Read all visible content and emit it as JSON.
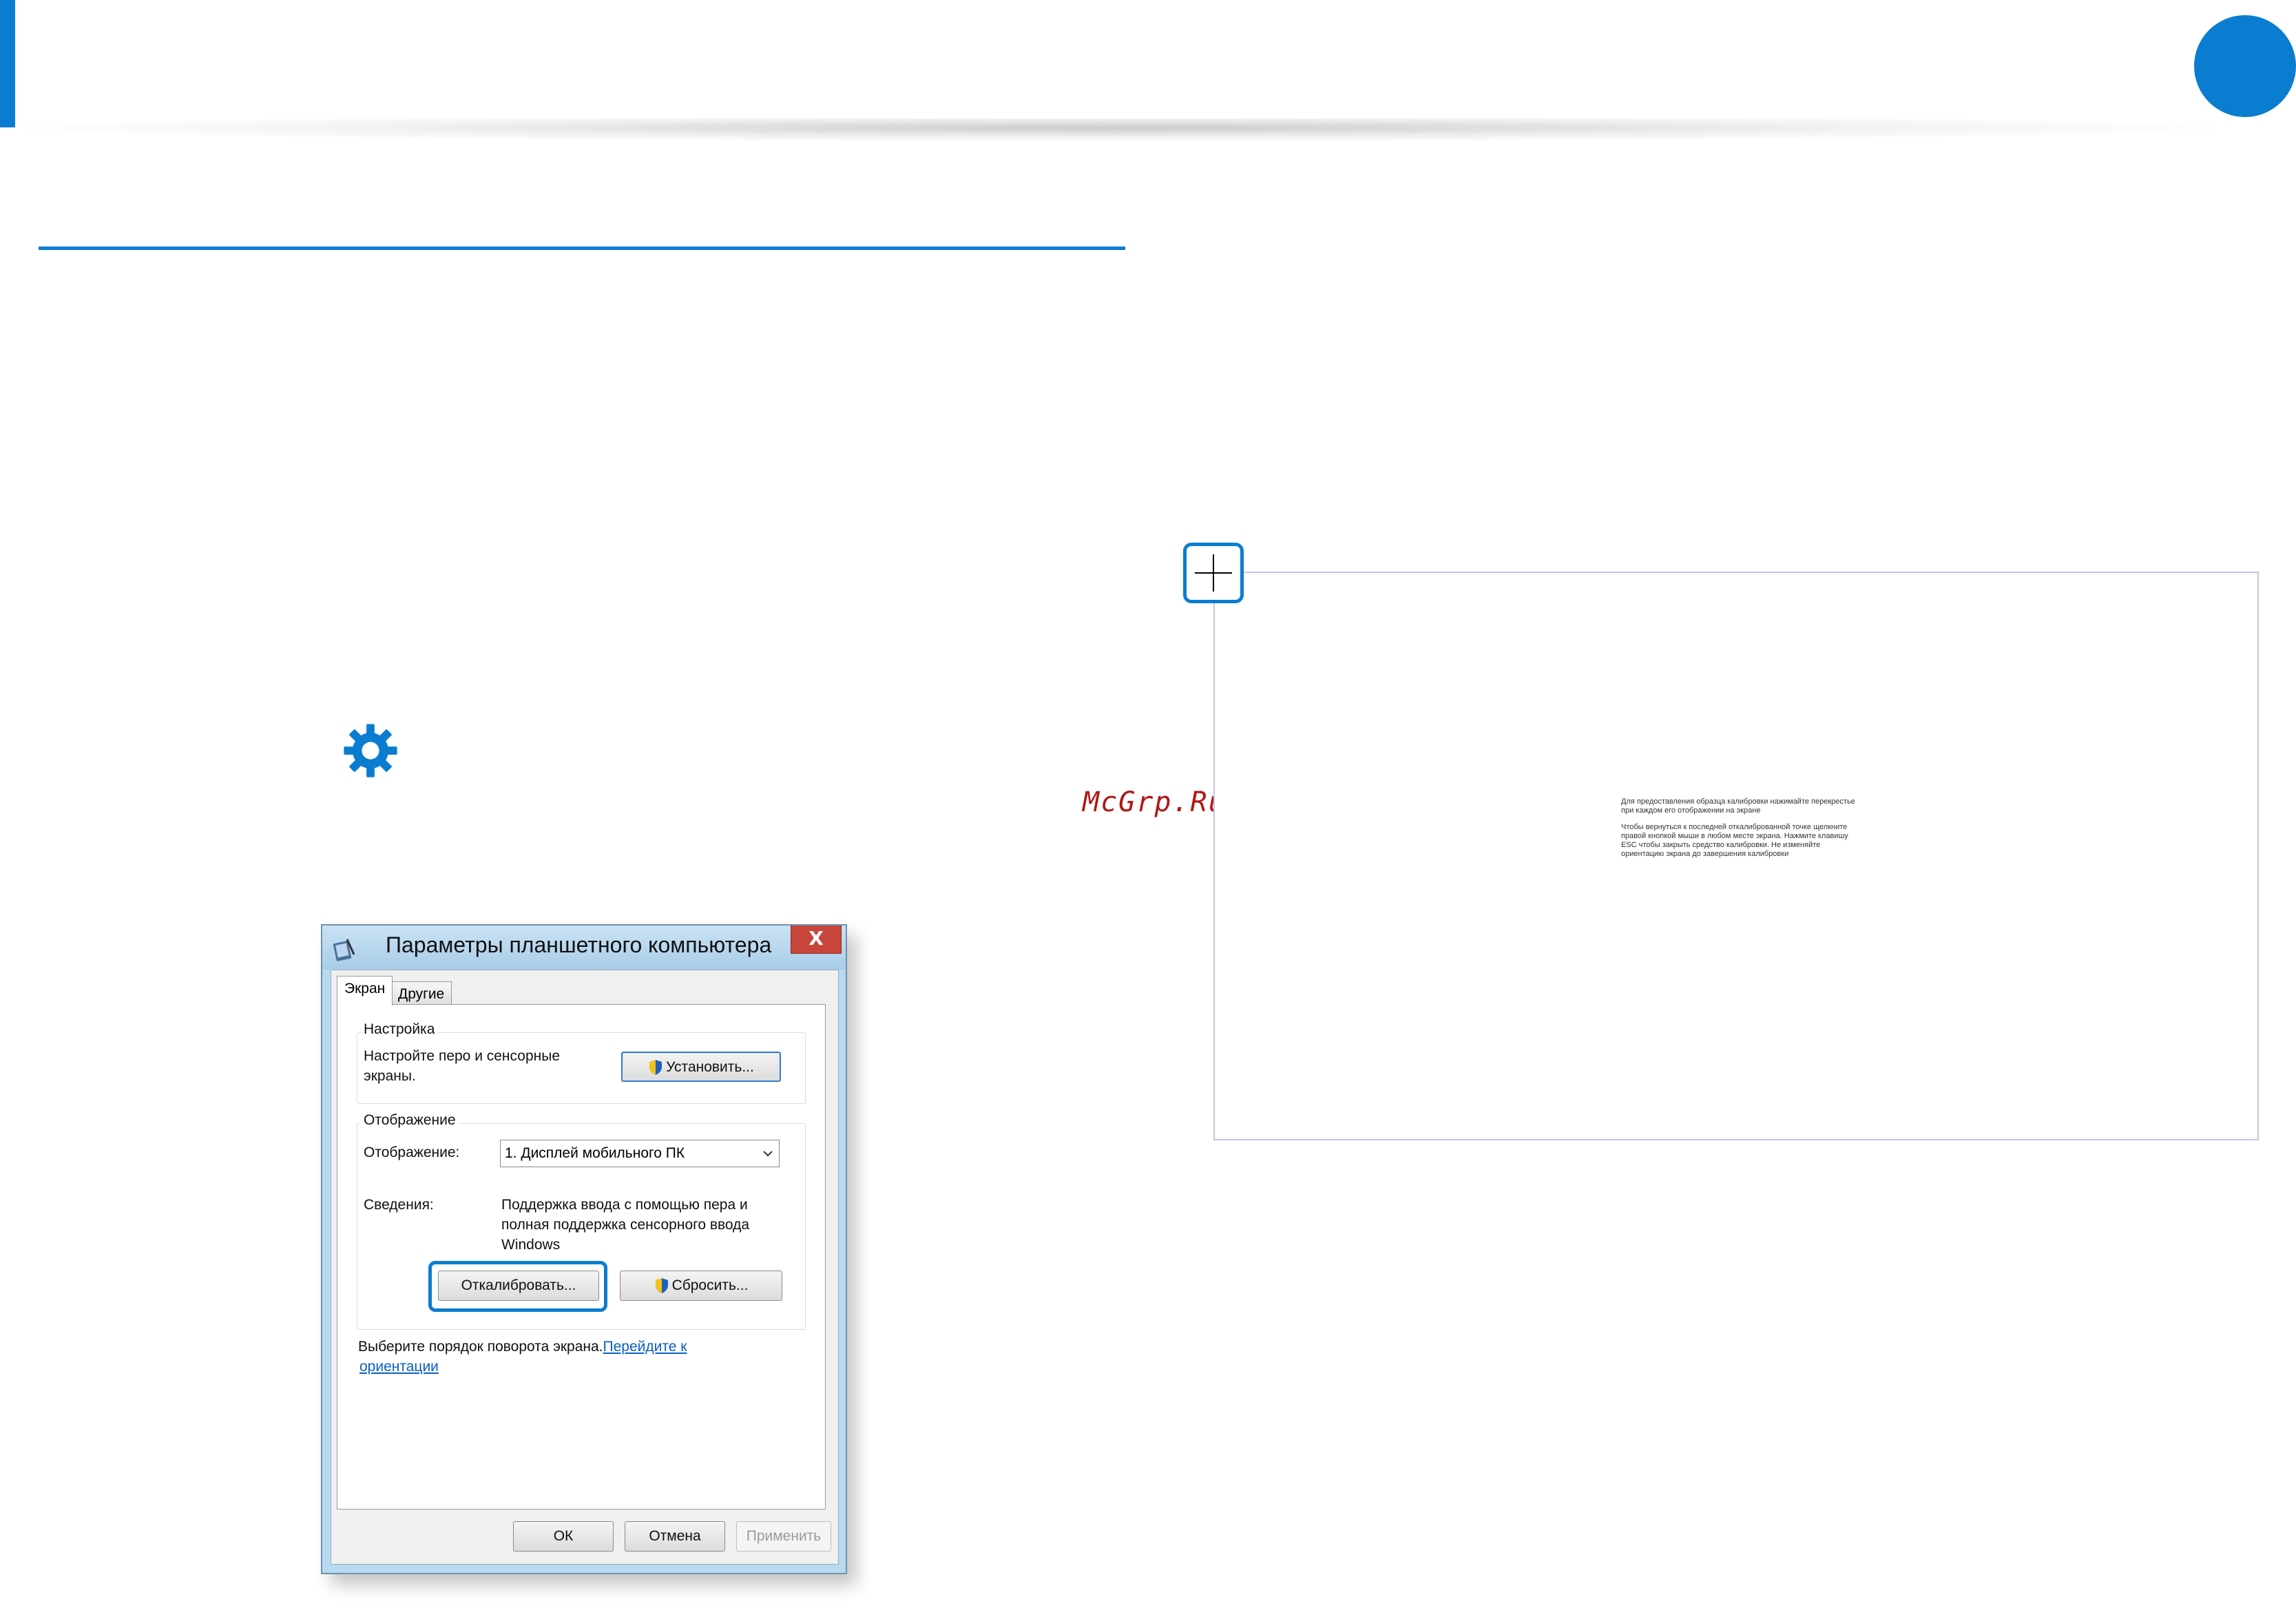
{
  "colors": {
    "accent": "#0b7dd0",
    "watermark": "#b01818",
    "link": "#0a5fc2"
  },
  "watermark": "McGrp.Ru",
  "dialog": {
    "title": "Параметры планшетного компьютера",
    "close_label": "X",
    "tabs": [
      {
        "label": "Экран",
        "selected": true
      },
      {
        "label": "Другие",
        "selected": false
      }
    ],
    "setup": {
      "legend": "Настройка",
      "description_line1": "Настройте перо и сенсорные",
      "description_line2": "экраны.",
      "button_label": "Установить..."
    },
    "display": {
      "legend": "Отображение",
      "display_label": "Отображение:",
      "display_value": "1. Дисплей мобильного ПК",
      "info_label": "Сведения:",
      "info_line1": "Поддержка ввода с помощью пера и",
      "info_line2": "полная поддержка сенсорного ввода",
      "info_line3": "Windows",
      "calibrate_label": "Откалибровать...",
      "reset_label": "Сбросить..."
    },
    "rotation": {
      "text": "Выберите порядок поворота экрана.",
      "link_part1": "Перейдите к",
      "link_part2": "ориентации"
    },
    "footer": {
      "ok": "ОК",
      "cancel": "Отмена",
      "apply": "Применить"
    }
  },
  "calibration": {
    "para1": "Для предоставления образца калибровки нажимайте перекрестье при каждом его отображении на экране",
    "para2": "Чтобы вернуться к последней откалиброванной точке щелкните правой кнопкой мыши в любом месте экрана. Нажмите клавишу ESC чтобы закрыть средство калибровки. Не изменяйте ориентацию экрана до завершения калибровки"
  },
  "icons": [
    "gear-icon",
    "tablet-pc-icon",
    "shield-icon",
    "chevron-down-icon",
    "crosshair-icon"
  ]
}
